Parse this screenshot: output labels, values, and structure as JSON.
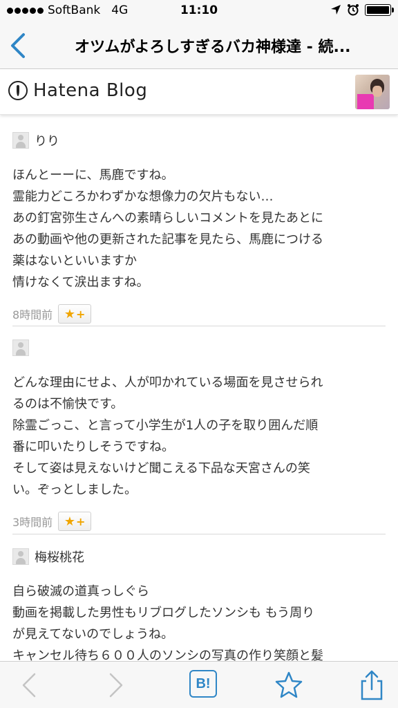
{
  "status_bar": {
    "carrier": "SoftBank",
    "network": "4G",
    "time": "11:10"
  },
  "nav": {
    "title": "オツムがよろしすぎるバカ神様達 - 続..."
  },
  "blog_header": {
    "logo_text": "Hatena Blog"
  },
  "comments": [
    {
      "user": "りり",
      "body": "ほんとーーに、馬鹿ですね。\n霊能力どころかわずかな想像力の欠片もない…\nあの釘宮弥生さんへの素晴らしいコメントを見たあとに\nあの動画や他の更新された記事を見たら、馬鹿につける\n薬はないといいますか\n情けなくて涙出ますね。",
      "time": "8時間前",
      "star_label": "★",
      "plus_label": "+"
    },
    {
      "user": "",
      "body": "どんな理由にせよ、人が叩かれている場面を見させられ\nるのは不愉快です。\n除霊ごっこ、と言って小学生が1人の子を取り囲んだ順\n番に叩いたりしそうですね。\nそして姿は見えないけど聞こえる下品な天宮さんの笑\nい。ぞっとしました。",
      "time": "3時間前",
      "star_label": "★",
      "plus_label": "+"
    },
    {
      "user": "梅桜桃花",
      "body": "自ら破滅の道真っしぐら\n動画を掲載した男性もリブログしたソンシも もう周り\nが見えてないのでしょうね。\nキャンセル待ち６００人のソンシの写真の作り笑顔と髪"
    }
  ],
  "toolbar": {
    "hatena_bookmark_label": "B!"
  },
  "colors": {
    "ios_blue": "#2f86c6",
    "star": "#f0a500"
  }
}
